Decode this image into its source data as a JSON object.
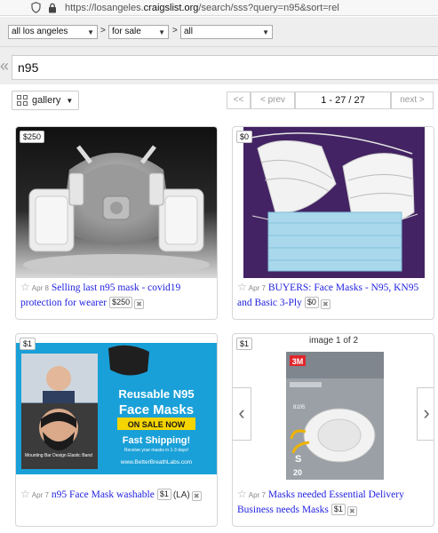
{
  "browser": {
    "url_prefix": "https://losangeles.",
    "url_domain": "craigslist.org",
    "url_suffix": "/search/sss?query=n95&sort=rel"
  },
  "filters": {
    "area": "all los angeles",
    "category": "for sale",
    "subcategory": "all",
    "separator": ">"
  },
  "search": {
    "value": "n95",
    "collapse_glyph": "«"
  },
  "toolbar": {
    "view_label": "gallery",
    "first_label": "<<",
    "prev_label": "< prev",
    "range_label": "1 - 27 / 27",
    "next_label": "next >"
  },
  "results": [
    {
      "price_tag": "$250",
      "date": "Apr 8",
      "title": "Selling last n95 mask - covid19 protection for wearer",
      "price": "$250",
      "location": ""
    },
    {
      "price_tag": "$0",
      "date": "Apr 7",
      "title": "BUYERS: Face Masks - N95, KN95 and Basic 3-Ply",
      "price": "$0",
      "location": ""
    },
    {
      "price_tag": "$1",
      "date": "Apr 7",
      "title": "n95 Face Mask washable",
      "price": "$1",
      "location": "(LA)",
      "image_text": {
        "headline1": "Reusable N95",
        "headline2": "Face Masks",
        "badge": "ON SALE NOW",
        "shipping": "Fast Shipping!",
        "shipping_sub": "Receive your masks in 1-3 days!",
        "site": "www.BetterBreathLabs.com",
        "inset_caption": "Mounting Bar Design Elastic Band"
      }
    },
    {
      "price_tag": "$1",
      "date": "Apr 7",
      "title": "Masks needed Essential Delivery Business needs Masks",
      "price": "$1",
      "location": "",
      "image_counter": "image 1 of 2",
      "image_text": {
        "brand": "3M",
        "model": "8105",
        "size": "S",
        "count": "20"
      }
    }
  ],
  "colors": {
    "link": "#1f1fe0",
    "ad_blue": "#1aa0d8",
    "ad_yellow": "#f5d400"
  }
}
